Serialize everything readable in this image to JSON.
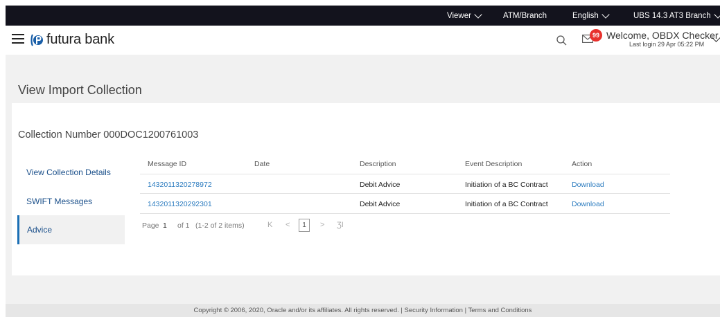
{
  "topbar": {
    "viewer": "Viewer",
    "atm_branch": "ATM/Branch",
    "language": "English",
    "branch": "UBS 14.3 AT3 Branch"
  },
  "header": {
    "brand": "futura bank",
    "notification_count": "99",
    "welcome": "Welcome, OBDX Checker",
    "last_login": "Last login 29 Apr 05:22 PM"
  },
  "page": {
    "title": "View Import Collection",
    "collection_number": "Collection Number 000DOC1200761003"
  },
  "sidebar": {
    "items": [
      {
        "label": "View Collection Details"
      },
      {
        "label": "SWIFT Messages"
      },
      {
        "label": "Advice"
      }
    ]
  },
  "table": {
    "columns": [
      "Message ID",
      "Date",
      "Description",
      "Event Description",
      "Action"
    ],
    "rows": [
      {
        "message_id": "1432011320278972",
        "date": "",
        "description": "Debit Advice",
        "event": "Initiation of a BC Contract",
        "action": "Download"
      },
      {
        "message_id": "1432011320292301",
        "date": "",
        "description": "Debit Advice",
        "event": "Initiation of a BC Contract",
        "action": "Download"
      }
    ]
  },
  "pagination": {
    "page_label": "Page",
    "page_value": "1",
    "of_label": "of 1",
    "items_label": "(1-2 of 2 items)",
    "current": "1",
    "first": "K",
    "prev": "<",
    "next": ">",
    "last": "ƷI"
  },
  "footer": {
    "text": "Copyright © 2006, 2020, Oracle and/or its affiliates. All rights reserved. | Security Information | Terms and Conditions"
  },
  "colors": {
    "topbar": "#13131d",
    "link": "#2b7bbf",
    "accent": "#1a6fb5",
    "badge": "#e8312d"
  }
}
